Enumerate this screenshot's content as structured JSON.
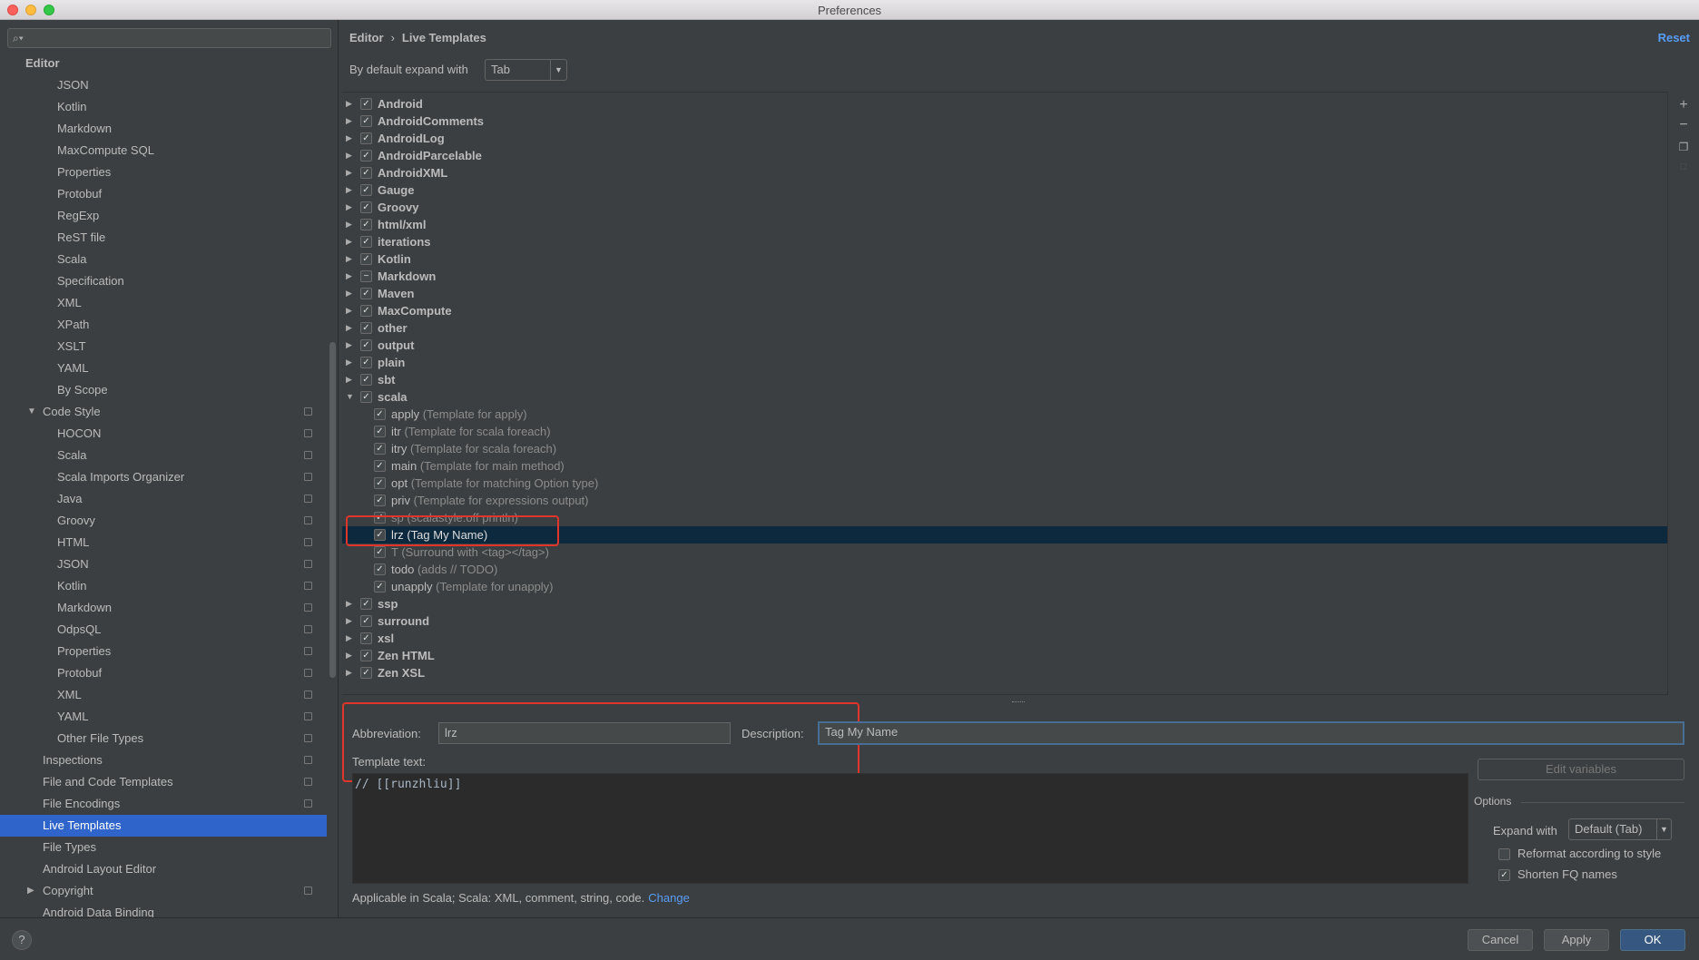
{
  "window": {
    "title": "Preferences"
  },
  "search": {
    "placeholder": ""
  },
  "sidebar": {
    "items": [
      {
        "label": "Editor",
        "level": 0,
        "bold": true
      },
      {
        "label": "JSON",
        "level": 2
      },
      {
        "label": "Kotlin",
        "level": 2
      },
      {
        "label": "Markdown",
        "level": 2
      },
      {
        "label": "MaxCompute SQL",
        "level": 2
      },
      {
        "label": "Properties",
        "level": 2
      },
      {
        "label": "Protobuf",
        "level": 2
      },
      {
        "label": "RegExp",
        "level": 2
      },
      {
        "label": "ReST file",
        "level": 2
      },
      {
        "label": "Scala",
        "level": 2
      },
      {
        "label": "Specification",
        "level": 2
      },
      {
        "label": "XML",
        "level": 2
      },
      {
        "label": "XPath",
        "level": 2
      },
      {
        "label": "XSLT",
        "level": 2
      },
      {
        "label": "YAML",
        "level": 2
      },
      {
        "label": "By Scope",
        "level": 2
      },
      {
        "label": "Code Style",
        "level": 1,
        "arrow": "down",
        "copy": true
      },
      {
        "label": "HOCON",
        "level": 2,
        "copy": true
      },
      {
        "label": "Scala",
        "level": 2,
        "copy": true
      },
      {
        "label": "Scala Imports Organizer",
        "level": 2,
        "copy": true
      },
      {
        "label": "Java",
        "level": 2,
        "copy": true
      },
      {
        "label": "Groovy",
        "level": 2,
        "copy": true
      },
      {
        "label": "HTML",
        "level": 2,
        "copy": true
      },
      {
        "label": "JSON",
        "level": 2,
        "copy": true
      },
      {
        "label": "Kotlin",
        "level": 2,
        "copy": true
      },
      {
        "label": "Markdown",
        "level": 2,
        "copy": true
      },
      {
        "label": "OdpsQL",
        "level": 2,
        "copy": true
      },
      {
        "label": "Properties",
        "level": 2,
        "copy": true
      },
      {
        "label": "Protobuf",
        "level": 2,
        "copy": true
      },
      {
        "label": "XML",
        "level": 2,
        "copy": true
      },
      {
        "label": "YAML",
        "level": 2,
        "copy": true
      },
      {
        "label": "Other File Types",
        "level": 2,
        "copy": true
      },
      {
        "label": "Inspections",
        "level": 1,
        "copy": true
      },
      {
        "label": "File and Code Templates",
        "level": 1,
        "copy": true
      },
      {
        "label": "File Encodings",
        "level": 1,
        "copy": true
      },
      {
        "label": "Live Templates",
        "level": 1,
        "selected": true
      },
      {
        "label": "File Types",
        "level": 1
      },
      {
        "label": "Android Layout Editor",
        "level": 1
      },
      {
        "label": "Copyright",
        "level": 1,
        "arrow": "right",
        "copy": true
      },
      {
        "label": "Android Data Binding",
        "level": 1
      }
    ]
  },
  "header": {
    "breadcrumb": [
      "Editor",
      "Live Templates"
    ],
    "reset_label": "Reset",
    "expand_label": "By default expand with",
    "expand_value": "Tab"
  },
  "templates": {
    "groups": [
      {
        "name": "Android",
        "checked": "on"
      },
      {
        "name": "AndroidComments",
        "checked": "on"
      },
      {
        "name": "AndroidLog",
        "checked": "on"
      },
      {
        "name": "AndroidParcelable",
        "checked": "on"
      },
      {
        "name": "AndroidXML",
        "checked": "on"
      },
      {
        "name": "Gauge",
        "checked": "on"
      },
      {
        "name": "Groovy",
        "checked": "on"
      },
      {
        "name": "html/xml",
        "checked": "on"
      },
      {
        "name": "iterations",
        "checked": "on"
      },
      {
        "name": "Kotlin",
        "checked": "on"
      },
      {
        "name": "Markdown",
        "checked": "partial"
      },
      {
        "name": "Maven",
        "checked": "on"
      },
      {
        "name": "MaxCompute",
        "checked": "on"
      },
      {
        "name": "other",
        "checked": "on"
      },
      {
        "name": "output",
        "checked": "on"
      },
      {
        "name": "plain",
        "checked": "on"
      },
      {
        "name": "sbt",
        "checked": "on"
      },
      {
        "name": "scala",
        "checked": "on",
        "expanded": true,
        "children": [
          {
            "abbr": "apply",
            "desc": "(Template for apply)"
          },
          {
            "abbr": "itr",
            "desc": "(Template for scala foreach)"
          },
          {
            "abbr": "itry",
            "desc": "(Template for scala foreach)"
          },
          {
            "abbr": "main",
            "desc": "(Template for main method)"
          },
          {
            "abbr": "opt",
            "desc": "(Template for matching Option type)"
          },
          {
            "abbr": "priv",
            "desc": "(Template for expressions output)"
          },
          {
            "abbr": "sp",
            "desc": "(scalastyle:off println)",
            "faded": true
          },
          {
            "abbr": "lrz",
            "desc": "(Tag My Name)",
            "selected": true
          },
          {
            "abbr": "T",
            "desc": "(Surround with <tag></tag>)",
            "faded": true
          },
          {
            "abbr": "todo",
            "desc": "(adds // TODO)"
          },
          {
            "abbr": "unapply",
            "desc": "(Template for unapply)"
          }
        ]
      },
      {
        "name": "ssp",
        "checked": "on"
      },
      {
        "name": "surround",
        "checked": "on"
      },
      {
        "name": "xsl",
        "checked": "on"
      },
      {
        "name": "Zen HTML",
        "checked": "on"
      },
      {
        "name": "Zen XSL",
        "checked": "on"
      }
    ]
  },
  "editor": {
    "abbreviation_label": "Abbreviation:",
    "abbreviation_value": "lrz",
    "description_label": "Description:",
    "description_value": "Tag My Name",
    "template_text_label": "Template text:",
    "template_text": "// [[runzhliu]]",
    "applicable_text": "Applicable in Scala; Scala: XML, comment, string, code.",
    "change_link": "Change",
    "edit_variables_label": "Edit variables",
    "options_title": "Options",
    "expand_with_label": "Expand with",
    "expand_with_value": "Default (Tab)",
    "reformat_label": "Reformat according to style",
    "reformat_checked": false,
    "shorten_label": "Shorten FQ names",
    "shorten_checked": true
  },
  "footer": {
    "help_label": "?",
    "cancel_label": "Cancel",
    "apply_label": "Apply",
    "ok_label": "OK"
  },
  "colors": {
    "accent": "#2f65ca",
    "link": "#589df6",
    "highlight_box": "#e0352b",
    "selected_row": "#0d293e"
  }
}
